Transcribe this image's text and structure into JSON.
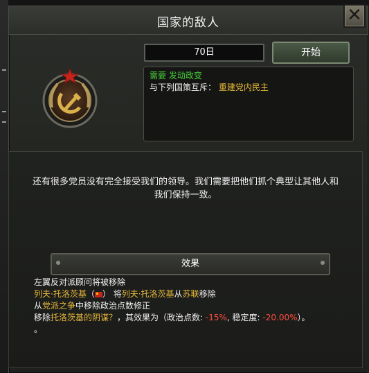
{
  "window": {
    "title": "国家的敌人",
    "close_glyph": "✕"
  },
  "timer": {
    "days": "70日"
  },
  "start_button": {
    "label": "开始"
  },
  "requirements": {
    "needs_prefix": "需要",
    "needs_value": "发动政变",
    "exclusive_prefix": "与下列国策互斥：",
    "exclusive_value": "重建党内民主"
  },
  "description": "还有很多党员没有完全接受我们的领导。我们需要把他们抓个典型让其他人和我们保持一致。",
  "effects_header": "效果",
  "effects": {
    "line1": "左翼反对派顾问将被移除",
    "line2_name1": "列夫·托洛茨基",
    "line2_paren_open": "（",
    "line2_paren_close": "）",
    "line2_mid": "将",
    "line2_name2": "列夫·托洛茨基",
    "line2_from": "从",
    "line2_country": "苏联",
    "line2_end": "移除",
    "line3_prefix": "从",
    "line3_idea": "党派之争",
    "line3_end": "中移除政治点数修正",
    "line4_prefix": "移除",
    "line4_idea": "托洛茨基的阴谋？",
    "line4_mid": "，其效果为（政治点数: ",
    "line4_val1": "-15%",
    "line4_sep": ", 稳定度: ",
    "line4_val2": "-20.00%",
    "line4_end": "）。",
    "line5": "。"
  },
  "icons": {
    "emblem": "hammer-sickle-emblem-icon",
    "flag": "ussr-flag-icon",
    "close": "close-icon"
  },
  "colors": {
    "green": "#49d13c",
    "gold": "#e8b93a",
    "red": "#ff4d3d"
  }
}
